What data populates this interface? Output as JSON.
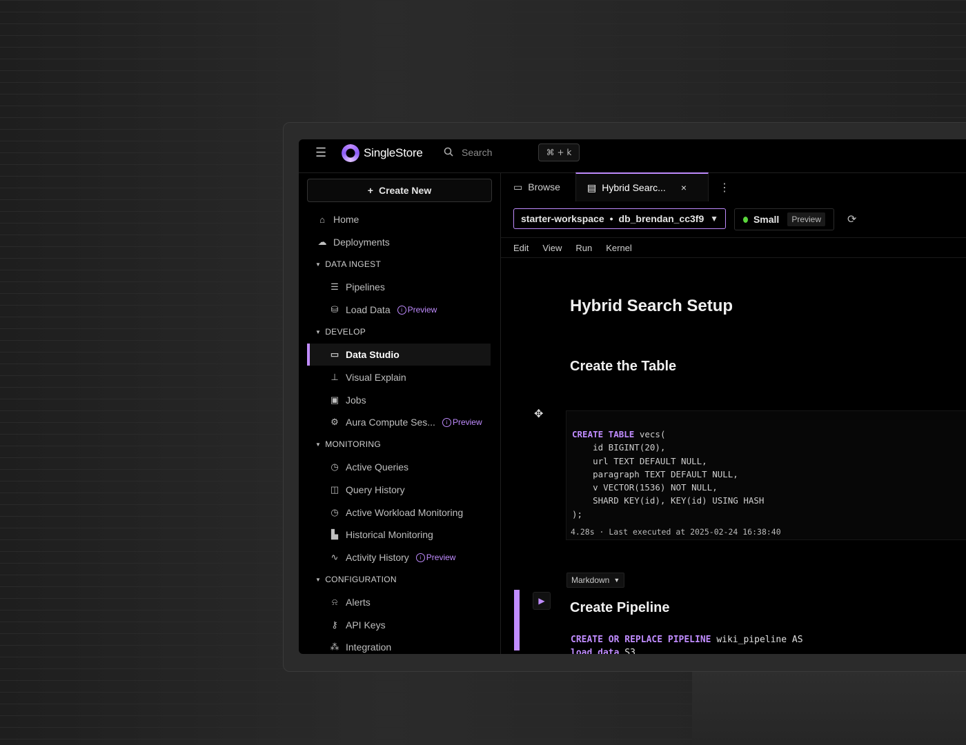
{
  "app": {
    "brand": "SingleStore",
    "search_placeholder": "Search",
    "shortcut": "⌘ + k"
  },
  "sidebar": {
    "create_new": "Create New",
    "items": [
      {
        "label": "Home"
      },
      {
        "label": "Deployments"
      }
    ],
    "sections": [
      {
        "title": "DATA INGEST",
        "items": [
          {
            "label": "Pipelines"
          },
          {
            "label": "Load Data",
            "badge": "Preview"
          }
        ]
      },
      {
        "title": "DEVELOP",
        "items": [
          {
            "label": "Data Studio"
          },
          {
            "label": "Visual Explain"
          },
          {
            "label": "Jobs"
          },
          {
            "label": "Aura Compute Ses...",
            "badge": "Preview"
          }
        ]
      },
      {
        "title": "MONITORING",
        "items": [
          {
            "label": "Active Queries"
          },
          {
            "label": "Query History"
          },
          {
            "label": "Active Workload Monitoring"
          },
          {
            "label": "Historical Monitoring"
          },
          {
            "label": "Activity History",
            "badge": "Preview"
          }
        ]
      },
      {
        "title": "CONFIGURATION",
        "items": [
          {
            "label": "Alerts"
          },
          {
            "label": "API Keys"
          },
          {
            "label": "Integration"
          }
        ]
      }
    ]
  },
  "tabs": [
    {
      "label": "Browse"
    },
    {
      "label": "Hybrid Searc..."
    }
  ],
  "toolbar": {
    "workspace": "starter-workspace",
    "database": "db_brendan_cc3f9",
    "size": "Small",
    "size_badge": "Preview"
  },
  "menu": [
    "Edit",
    "View",
    "Run",
    "Kernel"
  ],
  "notebook": {
    "title": "Hybrid Search Setup",
    "section1": "Create the Table",
    "code1": {
      "line1_kw": "CREATE TABLE",
      "line1_rest": " vecs(",
      "body": "    id BIGINT(20),\n    url TEXT DEFAULT NULL,\n    paragraph TEXT DEFAULT NULL,\n    v VECTOR(1536) NOT NULL,\n    SHARD KEY(id), KEY(id) USING HASH\n);",
      "exec": "4.28s · Last executed at 2025-02-24 16:38:40"
    },
    "cell_type": "Markdown",
    "section2": "Create Pipeline",
    "code2": {
      "line1_kw": "CREATE OR REPLACE PIPELINE",
      "line1_rest": " wiki_pipeline AS",
      "line2_kw": "load data",
      "line2_rest": " S3"
    }
  },
  "colors": {
    "accent": "#c08cff",
    "status_ok": "#5ad63c",
    "background": "#000000"
  }
}
